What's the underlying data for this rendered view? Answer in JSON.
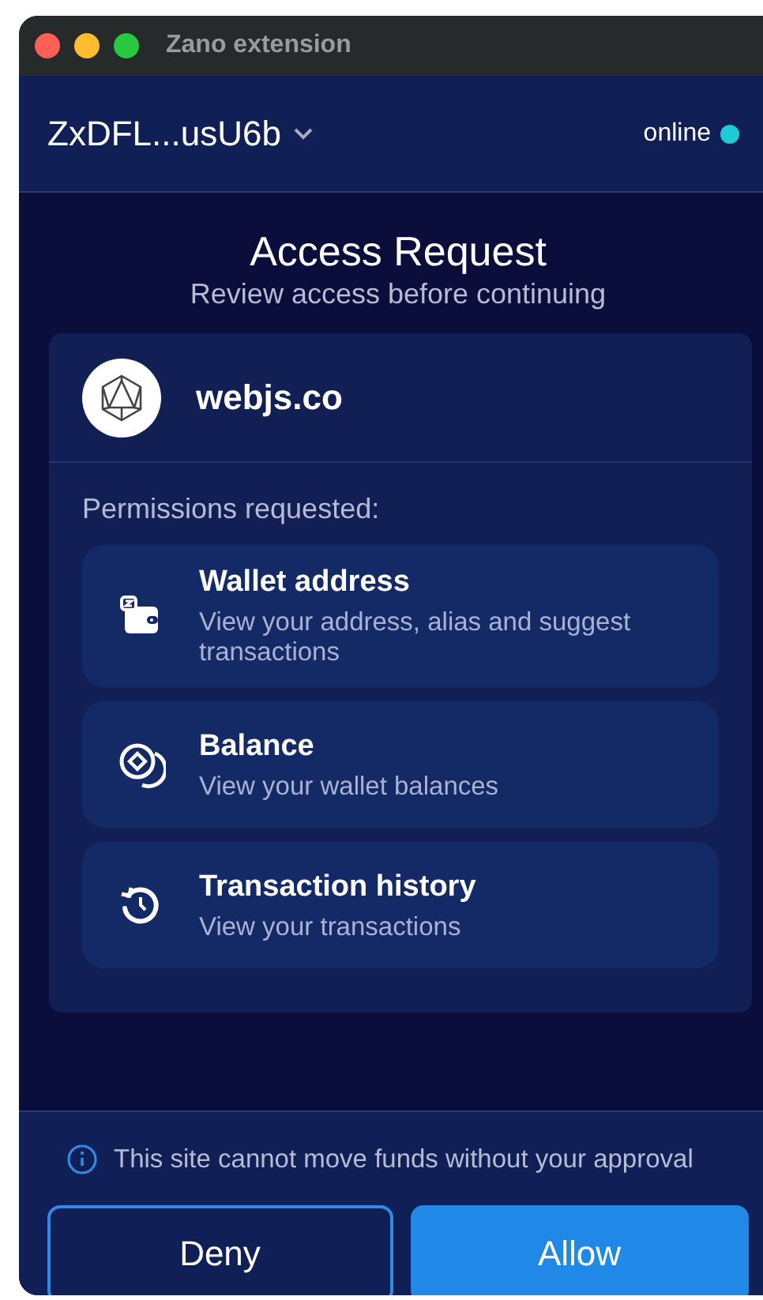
{
  "window": {
    "title": "Zano extension"
  },
  "header": {
    "wallet": "ZxDFL...usU6b",
    "status": {
      "label": "online",
      "online": true
    }
  },
  "request": {
    "title": "Access Request",
    "subtitle": "Review access before continuing"
  },
  "site": {
    "name": "webjs.co"
  },
  "permissions_label": "Permissions requested:",
  "permissions": [
    {
      "kind": "wallet",
      "title": "Wallet address",
      "description": "View your address, alias and suggest transactions"
    },
    {
      "kind": "balance",
      "title": "Balance",
      "description": "View your wallet balances"
    },
    {
      "kind": "history",
      "title": "Transaction history",
      "description": "View your transactions"
    }
  ],
  "notice": "This site cannot move funds without your approval",
  "buttons": [
    {
      "kind": "secondary",
      "label": "Deny"
    },
    {
      "kind": "primary",
      "label": "Allow"
    }
  ]
}
